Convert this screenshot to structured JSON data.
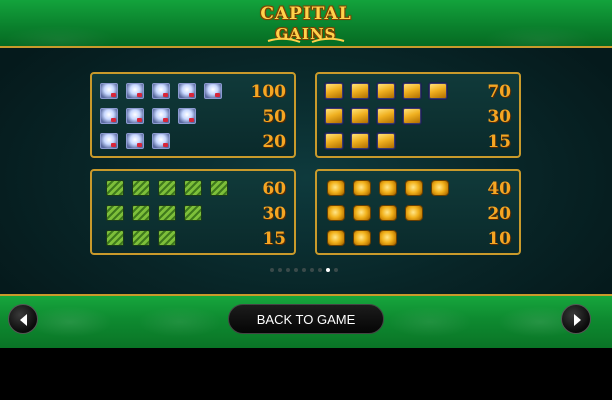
{
  "logo": {
    "line1": "CAPITAL",
    "line2": "GAINS"
  },
  "paytable": [
    {
      "symbol": "diamond-icon",
      "rows": [
        {
          "count": 5,
          "payout": "100"
        },
        {
          "count": 4,
          "payout": "50"
        },
        {
          "count": 3,
          "payout": "20"
        }
      ]
    },
    {
      "symbol": "gold-bars-icon",
      "rows": [
        {
          "count": 5,
          "payout": "70"
        },
        {
          "count": 4,
          "payout": "30"
        },
        {
          "count": 3,
          "payout": "15"
        }
      ]
    },
    {
      "symbol": "cash-stack-icon",
      "rows": [
        {
          "count": 5,
          "payout": "60"
        },
        {
          "count": 4,
          "payout": "30"
        },
        {
          "count": 3,
          "payout": "15"
        }
      ]
    },
    {
      "symbol": "gold-coins-icon",
      "rows": [
        {
          "count": 5,
          "payout": "40"
        },
        {
          "count": 4,
          "payout": "20"
        },
        {
          "count": 3,
          "payout": "10"
        }
      ]
    }
  ],
  "pagination": {
    "total": 9,
    "current": 8
  },
  "footer": {
    "back_label": "BACK TO GAME"
  },
  "colors": {
    "gold": "#c99a2b",
    "payout": "#f5a623",
    "green": "#0e8a30"
  }
}
